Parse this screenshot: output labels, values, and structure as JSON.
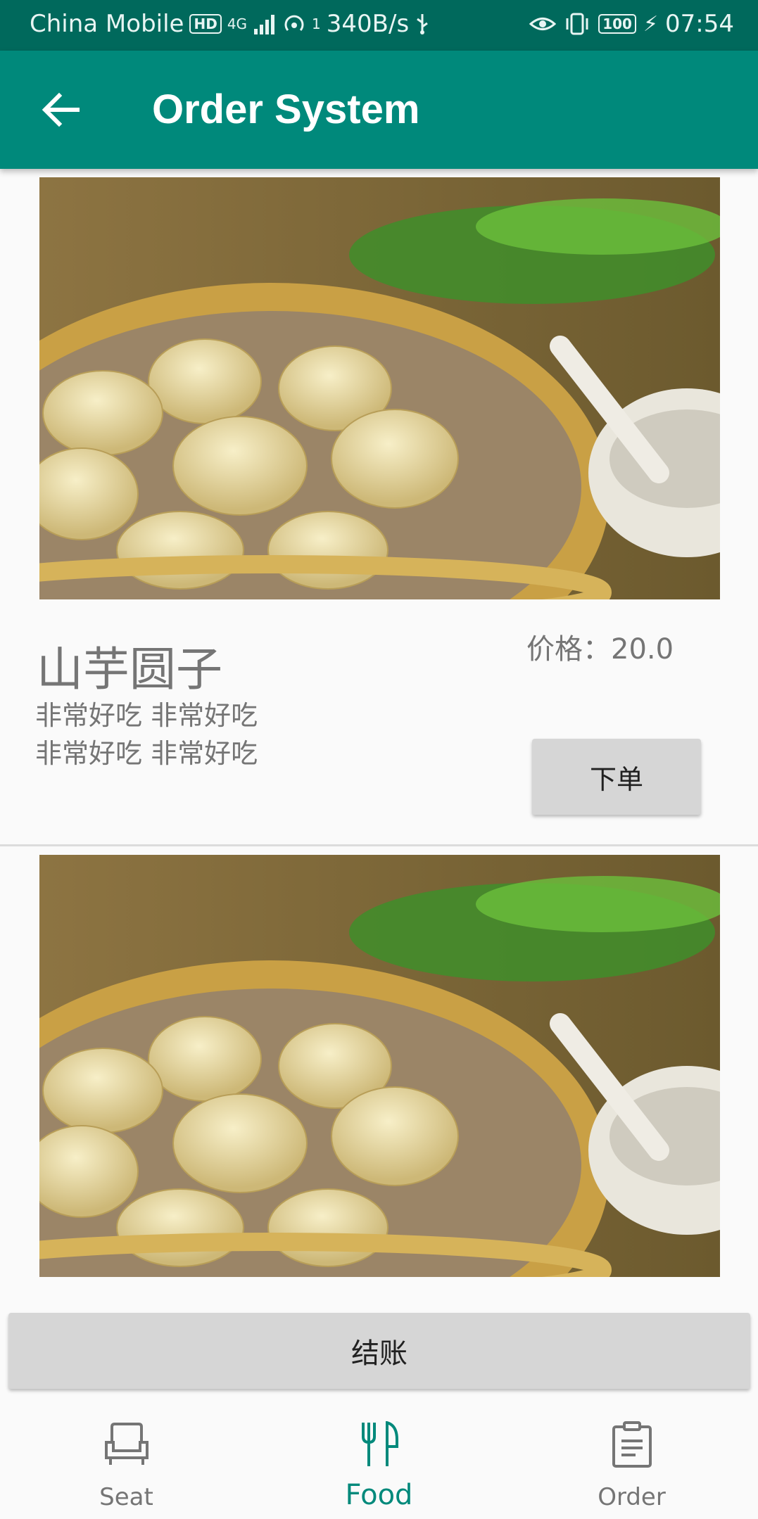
{
  "status_bar": {
    "carrier": "China Mobile",
    "hd_badge": "HD",
    "network": "4G",
    "hotspot_count": "1",
    "speed": "340B/s",
    "battery": "100",
    "time": "07:54"
  },
  "app_bar": {
    "title": "Order System",
    "back_icon": "arrow-left-icon"
  },
  "items": [
    {
      "name": "山芋圆子",
      "desc_line1": "非常好吃 非常好吃",
      "desc_line2": "非常好吃 非常好吃",
      "price": "价格：20.0",
      "order_label": "下单"
    }
  ],
  "checkout": {
    "label": "结账"
  },
  "bottom_nav": {
    "seat": {
      "label": "Seat",
      "icon": "armchair-icon"
    },
    "food": {
      "label": "Food",
      "icon": "fork-knife-icon"
    },
    "order": {
      "label": "Order",
      "icon": "clipboard-icon"
    }
  },
  "colors": {
    "primary": "#00897b",
    "primary_dark": "#00695c",
    "button": "#d6d6d6",
    "text_secondary": "#757575"
  }
}
